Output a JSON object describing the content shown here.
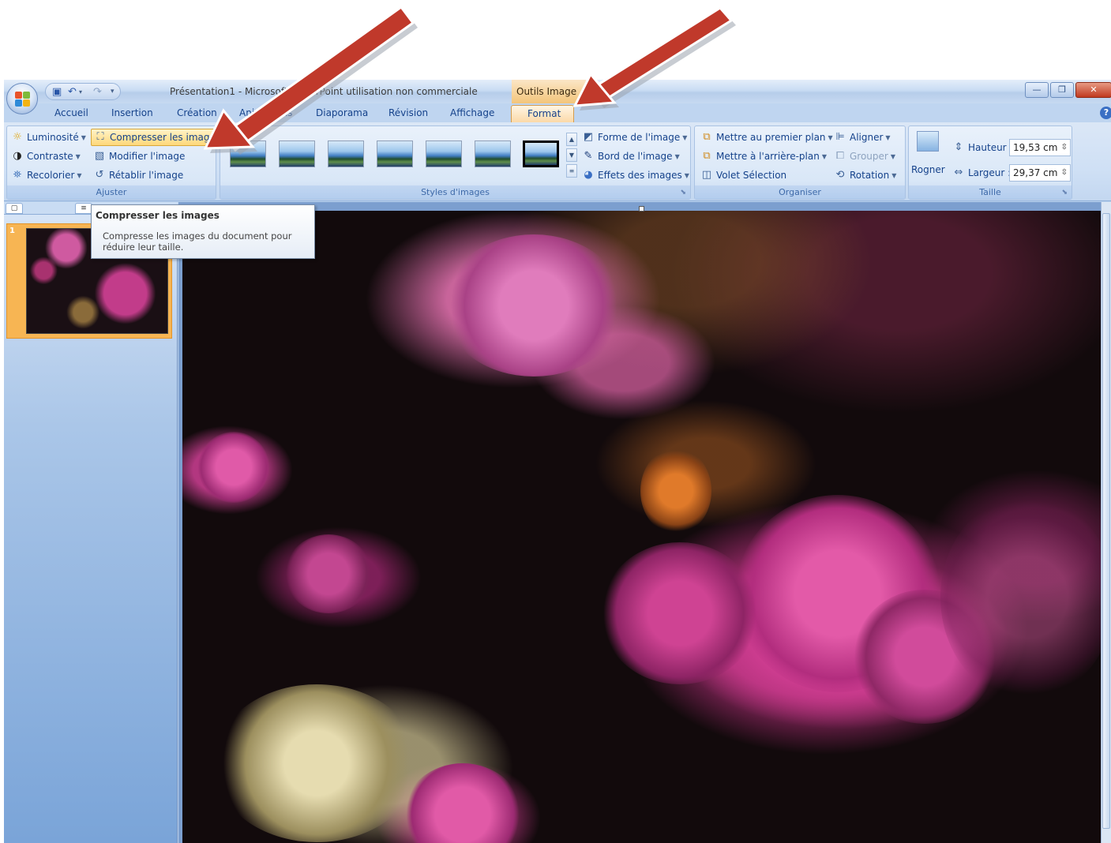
{
  "titlebar": {
    "title": "Présentation1 - Microsoft PowerPoint utilisation non commerciale",
    "contextual_tools": "Outils Image"
  },
  "tabs": [
    "Accueil",
    "Insertion",
    "Création",
    "Animations",
    "Diaporama",
    "Révision",
    "Affichage",
    "Format"
  ],
  "active_tab": "Format",
  "ribbon": {
    "ajuster": {
      "label": "Ajuster",
      "luminosite": "Luminosité",
      "contraste": "Contraste",
      "recolorier": "Recolorier",
      "compresser": "Compresser les images",
      "modifier": "Modifier l'image",
      "retablir": "Rétablir l'image"
    },
    "styles": {
      "label": "Styles d'images",
      "forme": "Forme de l'image",
      "bord": "Bord de l'image",
      "effets": "Effets des images"
    },
    "organiser": {
      "label": "Organiser",
      "premier_plan": "Mettre au premier plan",
      "arriere_plan": "Mettre à l'arrière-plan",
      "volet": "Volet Sélection",
      "aligner": "Aligner",
      "grouper": "Grouper",
      "rotation": "Rotation"
    },
    "taille": {
      "label": "Taille",
      "rogner": "Rogner",
      "hauteur_label": "Hauteur :",
      "hauteur_value": "19,53 cm",
      "largeur_label": "Largeur :",
      "largeur_value": "29,37 cm"
    }
  },
  "slides_panel": {
    "slide_number": "1"
  },
  "tooltip": {
    "title": "Compresser les images",
    "body": "Compresse les images du document pour réduire leur taille."
  },
  "colors": {
    "arrow": "#c0392b",
    "ribbon": "#dbe7f6",
    "active_tab": "#fbd9a8",
    "highlight": "#ffd87a"
  }
}
